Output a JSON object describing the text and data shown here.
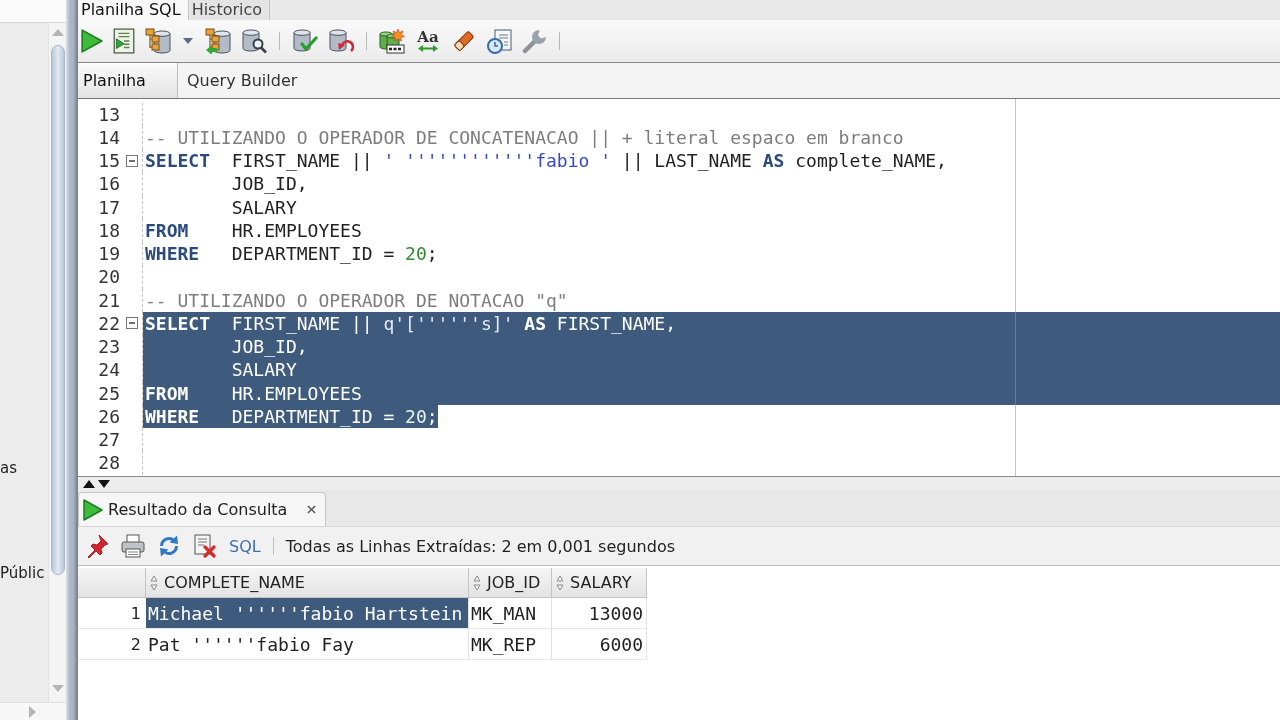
{
  "sidebar": {
    "items": [
      {
        "label": "as"
      },
      {
        "label": "Públic"
      }
    ]
  },
  "document_tabs": [
    {
      "label": "Planilha SQL",
      "selected": true
    },
    {
      "label": "Historico",
      "selected": false
    }
  ],
  "toolbar": {
    "change_case_label": "Aa"
  },
  "editor_tabs": [
    {
      "label": "Planilha",
      "selected": true
    },
    {
      "label": "Query Builder",
      "selected": false
    }
  ],
  "editor": {
    "lines": [
      {
        "number": "13",
        "selected": false,
        "foldable": false
      },
      {
        "number": "14",
        "selected": false,
        "foldable": false,
        "tokens": [
          {
            "kind": "comment",
            "text": "-- UTILIZANDO O OPERADOR DE CONCATENACAO || + literal espaco em branco"
          }
        ]
      },
      {
        "number": "15",
        "selected": false,
        "foldable": true,
        "tokens": [
          {
            "kind": "keyword",
            "text": "SELECT"
          },
          {
            "kind": "plain",
            "text": "  FIRST_NAME || "
          },
          {
            "kind": "string",
            "text": "' ''''''''''''fabio '"
          },
          {
            "kind": "plain",
            "text": " || LAST_NAME "
          },
          {
            "kind": "keyword",
            "text": "AS"
          },
          {
            "kind": "plain",
            "text": " complete_NAME,"
          }
        ]
      },
      {
        "number": "16",
        "selected": false,
        "foldable": false,
        "tokens": [
          {
            "kind": "plain",
            "text": "        JOB_ID,"
          }
        ]
      },
      {
        "number": "17",
        "selected": false,
        "foldable": false,
        "tokens": [
          {
            "kind": "plain",
            "text": "        SALARY"
          }
        ]
      },
      {
        "number": "18",
        "selected": false,
        "foldable": false,
        "tokens": [
          {
            "kind": "keyword",
            "text": "FROM"
          },
          {
            "kind": "plain",
            "text": "    HR.EMPLOYEES"
          }
        ]
      },
      {
        "number": "19",
        "selected": false,
        "foldable": false,
        "tokens": [
          {
            "kind": "keyword",
            "text": "WHERE"
          },
          {
            "kind": "plain",
            "text": "   DEPARTMENT_ID = "
          },
          {
            "kind": "number",
            "text": "20"
          },
          {
            "kind": "plain",
            "text": ";"
          }
        ]
      },
      {
        "number": "20",
        "selected": false,
        "foldable": false
      },
      {
        "number": "21",
        "selected": false,
        "foldable": false,
        "tokens": [
          {
            "kind": "comment",
            "text": "-- UTILIZANDO O OPERADOR DE NOTACAO \"q\""
          }
        ]
      },
      {
        "number": "22",
        "selected": true,
        "foldable": true,
        "tokens": [
          {
            "kind": "keyword",
            "text": "SELECT"
          },
          {
            "kind": "plain",
            "text": "  FIRST_NAME || "
          },
          {
            "kind": "string",
            "text": "q'[''''''s]'"
          },
          {
            "kind": "keyword",
            "text": " AS"
          },
          {
            "kind": "plain",
            "text": " FIRST_NAME,"
          }
        ]
      },
      {
        "number": "23",
        "selected": true,
        "foldable": false,
        "tokens": [
          {
            "kind": "plain",
            "text": "        JOB_ID,"
          }
        ]
      },
      {
        "number": "24",
        "selected": true,
        "foldable": false,
        "tokens": [
          {
            "kind": "plain",
            "text": "        SALARY"
          }
        ]
      },
      {
        "number": "25",
        "selected": true,
        "foldable": false,
        "tokens": [
          {
            "kind": "keyword",
            "text": "FROM"
          },
          {
            "kind": "plain",
            "text": "    HR.EMPLOYEES"
          }
        ]
      },
      {
        "number": "26",
        "selected": true,
        "foldable": false,
        "tokens": [
          {
            "kind": "keyword",
            "text": "WHERE"
          },
          {
            "kind": "plain",
            "text": "   DEPARTMENT_ID = "
          },
          {
            "kind": "number",
            "text": "20"
          },
          {
            "kind": "plain",
            "text": ";"
          }
        ]
      },
      {
        "number": "27",
        "selected": false,
        "foldable": false
      },
      {
        "number": "28",
        "selected": false,
        "foldable": false
      }
    ]
  },
  "results": {
    "tab": {
      "label": "Resultado da Consulta"
    },
    "sql_link": "SQL",
    "status": "Todas as Linhas Extraídas: 2 em 0,001 segundos",
    "table": {
      "columns": [
        {
          "label": "COMPLETE_NAME",
          "kind": "text"
        },
        {
          "label": "JOB_ID",
          "kind": "text"
        },
        {
          "label": "SALARY",
          "kind": "number"
        }
      ],
      "rows": [
        {
          "number": "1",
          "cells": [
            {
              "value": "Michael ''''''fabio Hartstein",
              "selected": true
            },
            {
              "value": "MK_MAN",
              "selected": false
            },
            {
              "value": "13000",
              "selected": false
            }
          ]
        },
        {
          "number": "2",
          "cells": [
            {
              "value": "Pat ''''''fabio Fay",
              "selected": false
            },
            {
              "value": "MK_REP",
              "selected": false
            },
            {
              "value": "6000",
              "selected": false
            }
          ]
        }
      ]
    }
  }
}
